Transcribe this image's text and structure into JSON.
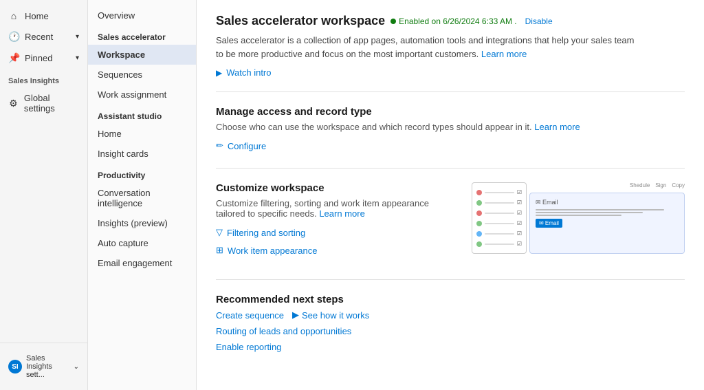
{
  "leftNav": {
    "items": [
      {
        "label": "Home",
        "icon": "⌂",
        "hasChevron": false
      },
      {
        "label": "Recent",
        "icon": "🕐",
        "hasChevron": true
      },
      {
        "label": "Pinned",
        "icon": "📌",
        "hasChevron": true
      }
    ],
    "sectionLabel": "Sales Insights",
    "globalSettings": {
      "label": "Global settings",
      "icon": "⚙"
    }
  },
  "rightSidebar": {
    "overview": "Overview",
    "salesAcceleratorSection": "Sales accelerator",
    "items": [
      "Workspace",
      "Sequences",
      "Work assignment"
    ],
    "assistantStudioSection": "Assistant studio",
    "assistantItems": [
      "Home",
      "Insight cards"
    ],
    "productivitySection": "Productivity",
    "productivityItems": [
      "Conversation intelligence",
      "Insights (preview)",
      "Auto capture",
      "Email engagement"
    ]
  },
  "main": {
    "title": "Sales accelerator workspace",
    "statusText": "Enabled on 6/26/2024 6:33 AM .",
    "disableLabel": "Disable",
    "description": "Sales accelerator is a collection of app pages, automation tools and integrations that help your sales team to be more productive and focus on the most important customers.",
    "learnMoreText": "Learn more",
    "watchIntroLabel": "Watch intro",
    "manageAccess": {
      "title": "Manage access and record type",
      "description": "Choose who can use the workspace and which record types should appear in it.",
      "learnMoreText": "Learn more",
      "configureLabel": "Configure"
    },
    "customizeWorkspace": {
      "title": "Customize workspace",
      "description": "Customize filtering, sorting and work item appearance tailored to specific needs.",
      "learnMoreText": "Learn more",
      "filteringSortingLabel": "Filtering and sorting",
      "workItemLabel": "Work item appearance"
    },
    "recommendedNextSteps": {
      "title": "Recommended next steps",
      "createSequenceLabel": "Create sequence",
      "seeHowLabel": "See how it works",
      "routingLabel": "Routing of leads and opportunities",
      "enableReportingLabel": "Enable reporting"
    }
  },
  "bottomBar": {
    "label": "Sales Insights sett...",
    "avatarText": "SI"
  },
  "preview": {
    "rows": [
      {
        "color": "#e57373"
      },
      {
        "color": "#81c784"
      },
      {
        "color": "#e57373"
      },
      {
        "color": "#81c784"
      },
      {
        "color": "#64b5f6"
      },
      {
        "color": "#81c784"
      }
    ],
    "cardTitle": "Email",
    "topBarItems": [
      "Shedule",
      "Sign",
      "Copy"
    ]
  }
}
